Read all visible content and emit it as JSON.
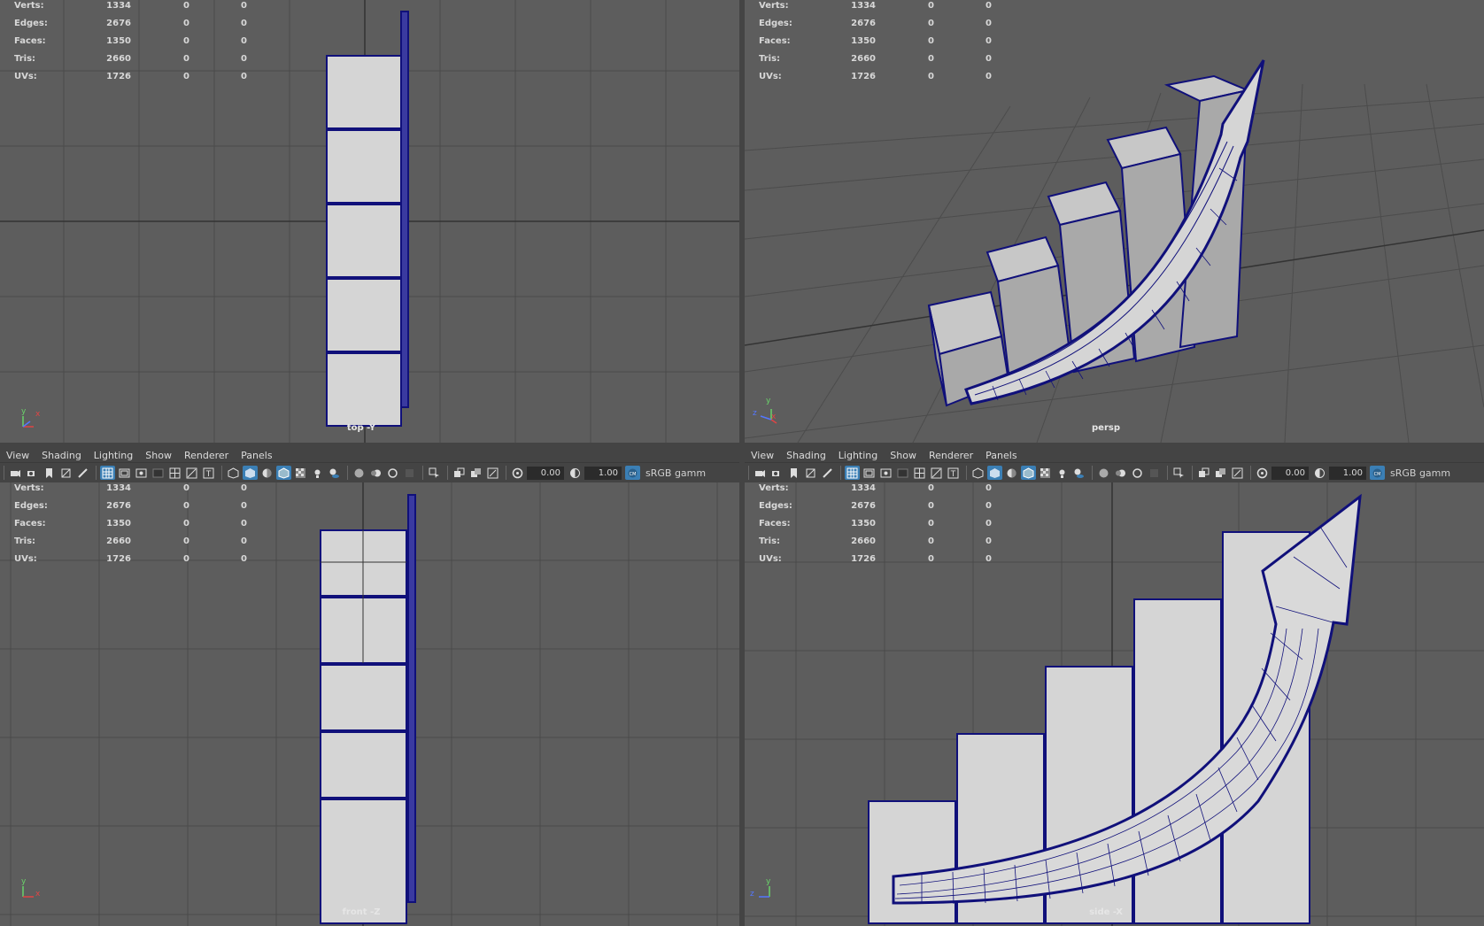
{
  "hud": {
    "rows": [
      {
        "label": "Verts:",
        "v1": "1334",
        "v2": "0",
        "v3": "0"
      },
      {
        "label": "Edges:",
        "v1": "2676",
        "v2": "0",
        "v3": "0"
      },
      {
        "label": "Faces:",
        "v1": "1350",
        "v2": "0",
        "v3": "0"
      },
      {
        "label": "Tris:",
        "v1": "2660",
        "v2": "0",
        "v3": "0"
      },
      {
        "label": "UVs:",
        "v1": "1726",
        "v2": "0",
        "v3": "0"
      }
    ]
  },
  "menu": {
    "view": "View",
    "shading": "Shading",
    "lighting": "Lighting",
    "show": "Show",
    "renderer": "Renderer",
    "panels": "Panels"
  },
  "toolbar": {
    "exposure": "0.00",
    "gamma": "1.00",
    "colorspace": "sRGB gamm"
  },
  "viewports": {
    "top": {
      "camera": "top -Y"
    },
    "persp": {
      "camera": "persp"
    },
    "front": {
      "camera": "front -Z"
    },
    "side": {
      "camera": "side -X"
    }
  },
  "axes": {
    "x": "x",
    "y": "y",
    "z": "z"
  },
  "colors": {
    "viewport_bg": "#5d5d5d",
    "grid": "#4a4a4a",
    "mesh_fill": "#d5d5d5",
    "wire": "#10107a",
    "panel": "#444444",
    "highlight": "#3b7fb5"
  }
}
